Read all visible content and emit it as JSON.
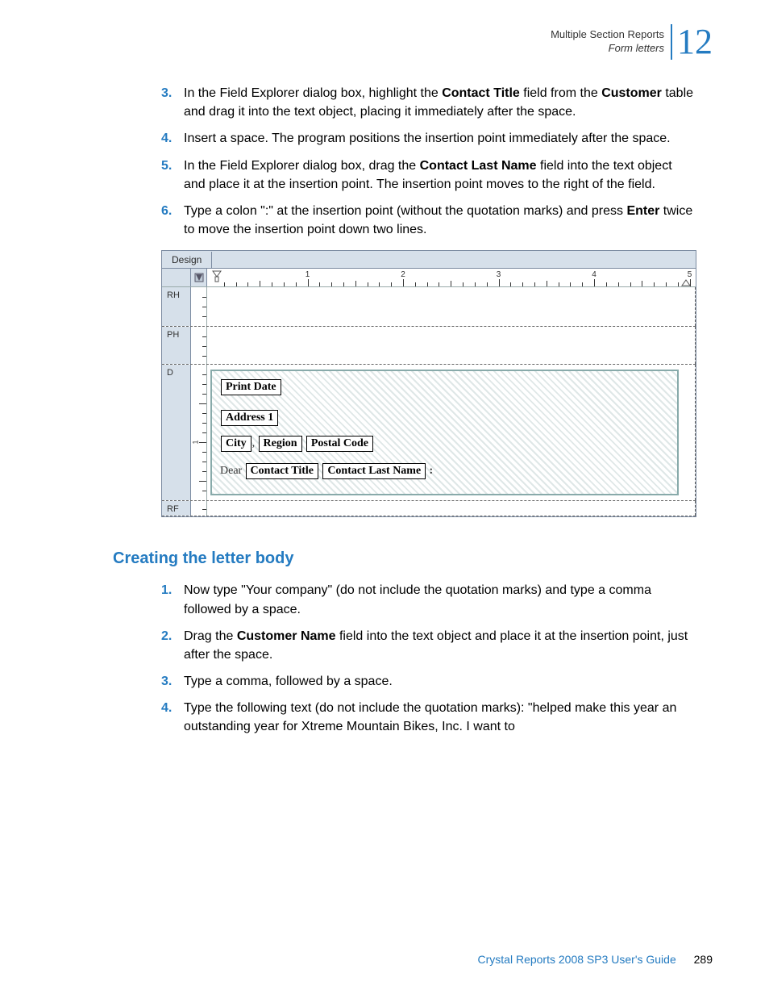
{
  "header": {
    "chapter": "Multiple Section Reports",
    "section": "Form letters",
    "chapter_number": "12"
  },
  "steps_a": [
    {
      "n": "3.",
      "before": "In the Field Explorer dialog box, highlight the ",
      "b1": "Contact Title",
      "mid": " field from the ",
      "b2": "Customer",
      "after": " table and drag it into the text object, placing it immediately after the space."
    },
    {
      "n": "4.",
      "text": "Insert a space. The program positions the insertion point immediately after the space."
    },
    {
      "n": "5.",
      "before": "In the Field Explorer dialog box, drag the ",
      "b1": "Contact Last Name",
      "after": " field into the text object and place it at the insertion point. The insertion point moves to the right of the field."
    },
    {
      "n": "6.",
      "before": "Type a colon \":\" at the insertion point (without the quotation marks) and press ",
      "b1": "Enter",
      "after": " twice to move the insertion point down two lines."
    }
  ],
  "designview": {
    "tab": "Design",
    "sections": {
      "rh": "RH",
      "ph": "PH",
      "d": "D",
      "rf": "RF"
    },
    "ruler_numbers": [
      "1",
      "2",
      "3",
      "4",
      "5"
    ],
    "fields": {
      "print_date": "Print Date",
      "address1": "Address 1",
      "city": "City",
      "region": "Region",
      "postal": "Postal Code",
      "dear": "Dear",
      "ctitle": "Contact Title",
      "clast": "Contact Last Name",
      "colon": ":",
      "comma": ","
    }
  },
  "section_heading": "Creating the letter body",
  "steps_b": [
    {
      "n": "1.",
      "text": "Now type \"Your company\" (do not include the quotation marks) and type a comma followed by a space."
    },
    {
      "n": "2.",
      "before": "Drag the ",
      "b1": "Customer Name",
      "after": " field into the text object and place it at the insertion point, just after the space."
    },
    {
      "n": "3.",
      "text": "Type a comma, followed by a space."
    },
    {
      "n": "4.",
      "text": "Type the following text (do not include the quotation marks): \"helped make this year an outstanding year for Xtreme Mountain Bikes, Inc. I want to"
    }
  ],
  "footer": {
    "guide": "Crystal Reports 2008 SP3 User's Guide",
    "page": "289"
  }
}
